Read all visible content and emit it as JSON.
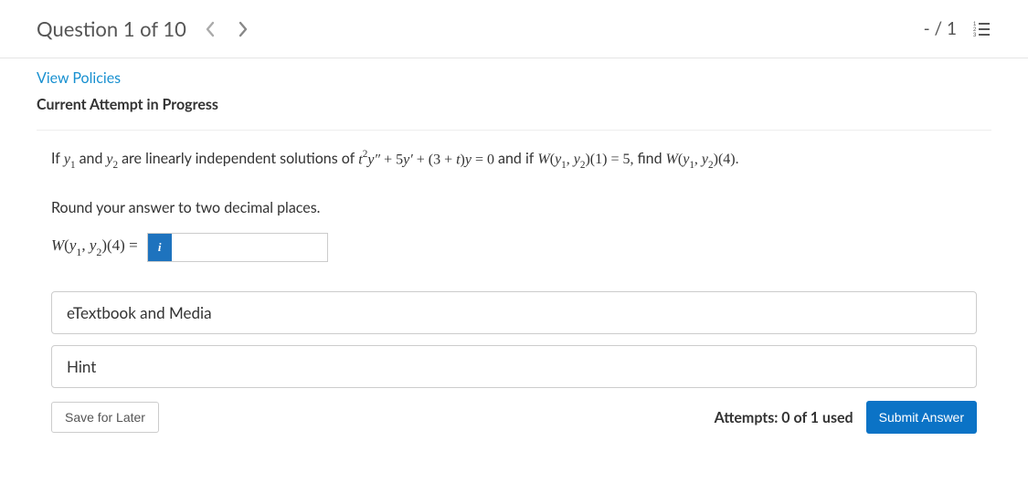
{
  "header": {
    "title": "Question 1 of 10",
    "score": "- / 1"
  },
  "links": {
    "policies": "View Policies"
  },
  "status": {
    "label": "Current Attempt in Progress"
  },
  "problem": {
    "prefix": "If ",
    "y1": "y",
    "y1_sub": "1",
    "and": " and ",
    "y2": "y",
    "y2_sub": "2",
    "linearly": " are linearly independent solutions of ",
    "equation_t": "t",
    "equation_t_sup": "2",
    "equation_ypp": "y″",
    "equation_plus1": " + 5",
    "equation_yp": "y′",
    "equation_plus2": " + (3 + ",
    "equation_tvar": "t",
    "equation_close": ")",
    "equation_yvar": "y",
    "equation_eq0": " = 0",
    "and_if": " and if ",
    "w1_W": "W",
    "w1_open": "(",
    "w1_y1": "y",
    "w1_y1_sub": "1",
    "w1_comma": ", ",
    "w1_y2": "y",
    "w1_y2_sub": "2",
    "w1_close_arg": ")(1) = 5,",
    "find": " find ",
    "w2_W": "W",
    "w2_open": "(",
    "w2_y1": "y",
    "w2_y1_sub": "1",
    "w2_comma": ", ",
    "w2_y2": "y",
    "w2_y2_sub": "2",
    "w2_close_arg": ")(4).",
    "round": "Round your answer to two decimal places."
  },
  "answer": {
    "label_W": "W",
    "label_open": "(",
    "label_y1": "y",
    "label_y1_sub": "1",
    "label_comma": ", ",
    "label_y2": "y",
    "label_y2_sub": "2",
    "label_close": ")(4) = ",
    "info": "i",
    "value": ""
  },
  "accordions": {
    "etextbook": "eTextbook and Media",
    "hint": "Hint"
  },
  "footer": {
    "save": "Save for Later",
    "attempts": "Attempts: 0 of 1 used",
    "submit": "Submit Answer"
  }
}
